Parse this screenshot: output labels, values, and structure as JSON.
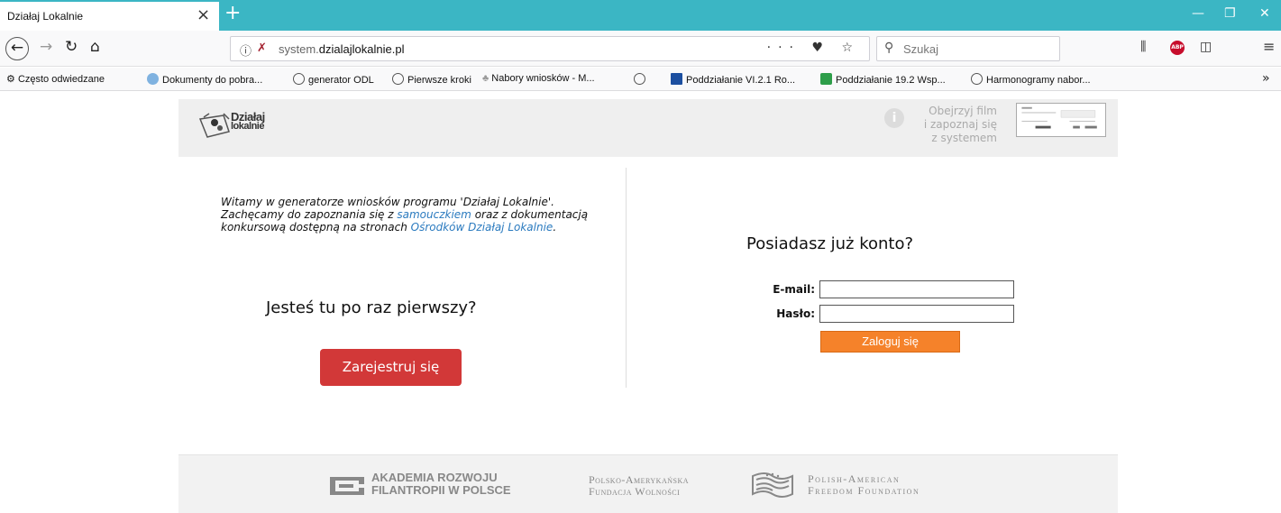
{
  "browser": {
    "tab_title": "Działaj Lokalnie",
    "tab_close": "×",
    "new_tab": "+",
    "url_prefix": "system.",
    "url_domain": "dzialajlokalnie.pl",
    "url_actions": "··· ♥ ☆",
    "search_placeholder": "Szukaj"
  },
  "bookmarks": [
    {
      "label": "Często odwiedzane",
      "icon": "gear-icon",
      "color": "#555555"
    },
    {
      "label": "Dokumenty do pobra...",
      "icon": "globe-icon",
      "color": "#2a7abf"
    },
    {
      "label": "generator ODL",
      "icon": "globe-icon",
      "color": "#555555"
    },
    {
      "label": "Pierwsze kroki",
      "icon": "globe-icon",
      "color": "#555555"
    },
    {
      "label": "Nabory wniosków - M...",
      "icon": "tree-icon",
      "color": "#8a8a8a"
    },
    {
      "label": "",
      "icon": "globe-icon",
      "color": "#555555"
    },
    {
      "label": "Poddziałanie VI.2.1 Ro...",
      "icon": "eu-flag-icon",
      "color": "#1c4fa0"
    },
    {
      "label": "Poddziałanie 19.2 Wsp...",
      "icon": "green-icon",
      "color": "#2e9e4a"
    },
    {
      "label": "Harmonogramy nabor...",
      "icon": "globe-icon",
      "color": "#555555"
    }
  ],
  "header": {
    "logo_line1": "Działaj",
    "logo_line2": "lokalnie",
    "film_line1": "Obejrzyj film",
    "film_line2": "i zapoznaj się",
    "film_line3": "z systemem"
  },
  "left": {
    "welcome_1": "Witamy w generatorze wniosków programu 'Działaj Lokalnie'. Zachęcamy do zapoznania się z ",
    "welcome_link1": "samouczkiem",
    "welcome_2": " oraz z dokumentacją konkursową dostępną na stronach ",
    "welcome_link2": "Ośrodków Działaj Lokalnie",
    "welcome_3": ".",
    "first_time": "Jesteś tu po raz pierwszy?",
    "register": "Zarejestruj się"
  },
  "right": {
    "have_account": "Posiadasz już konto?",
    "email_label": "E-mail:",
    "password_label": "Hasło:",
    "email_value": "",
    "password_value": "",
    "login": "Zaloguj się"
  },
  "footer": {
    "arfp_line1": "AKADEMIA ROZWOJU",
    "arfp_line2": "FILANTROPII W POLSCE",
    "pafw_line1": "Polsko-Amerykańska",
    "pafw_line2": "Fundacja Wolności",
    "pff_line1": "Polish-American",
    "pff_line2": "Freedom Foundation"
  }
}
